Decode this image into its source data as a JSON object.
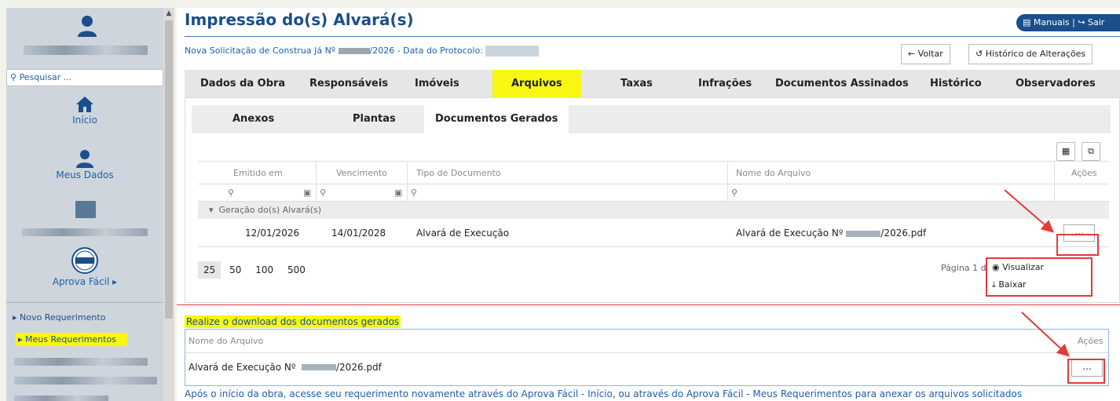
{
  "sidebar": {
    "search_placeholder": "Pesquisar ...",
    "nav": [
      {
        "label": "Início",
        "icon": "home-icon"
      },
      {
        "label": "Meus Dados",
        "icon": "user-icon"
      },
      {
        "label": "Aprova Fácil ▸",
        "icon": "aprova-facil-logo"
      }
    ],
    "links": [
      "▸ Novo Requerimento",
      "▸ Meus Requerimentos"
    ]
  },
  "header": {
    "title": "Impressão do(s) Alvará(s)",
    "manuals": "Manuais",
    "logout": "Sair",
    "subtitle_prefix": "Nova Solicitação de Construa Já Nº",
    "subtitle_mid": "/2026 - Data do Protocolo:",
    "back_label": "Voltar",
    "history_label": "Histórico de Alterações"
  },
  "tabs": [
    "Dados da Obra",
    "Responsáveis",
    "Imóveis",
    "Arquivos",
    "Taxas",
    "Infrações",
    "Documentos Assinados",
    "Histórico",
    "Observadores"
  ],
  "active_tab": "Arquivos",
  "subtabs": [
    "Anexos",
    "Plantas",
    "Documentos Gerados"
  ],
  "active_subtab": "Documentos Gerados",
  "grid": {
    "columns": [
      "Emitido em",
      "Vencimento",
      "Tipo de Documento",
      "Nome do Arquivo",
      "Ações"
    ],
    "group_label": "Geração do(s) Alvará(s)",
    "row": {
      "emitido": "12/01/2026",
      "vencimento": "14/01/2028",
      "tipo": "Alvará de Execução",
      "nome_prefix": "Alvará de Execução Nº",
      "nome_suffix": "/2026.pdf",
      "actions": "..."
    },
    "page_sizes": [
      "25",
      "50",
      "100",
      "500"
    ],
    "page_info": "Página 1 de"
  },
  "actions_menu": [
    "Visualizar",
    "Baixar"
  ],
  "download_section": {
    "label": "Realize o download dos documentos gerados",
    "col_name": "Nome do Arquivo",
    "col_actions": "Ações",
    "file_prefix": "Alvará de Execução Nº",
    "file_suffix": "/2026.pdf",
    "actions": "..."
  },
  "footer_note": "Após o início da obra, acesse seu requerimento novamente através do Aprova Fácil - Início, ou através do Aprova Fácil - Meus Requerimentos para anexar os arquivos solicitados",
  "colors": {
    "brand": "#1a4f8b",
    "highlight": "#f7f712",
    "annotation": "#e23a3a"
  }
}
